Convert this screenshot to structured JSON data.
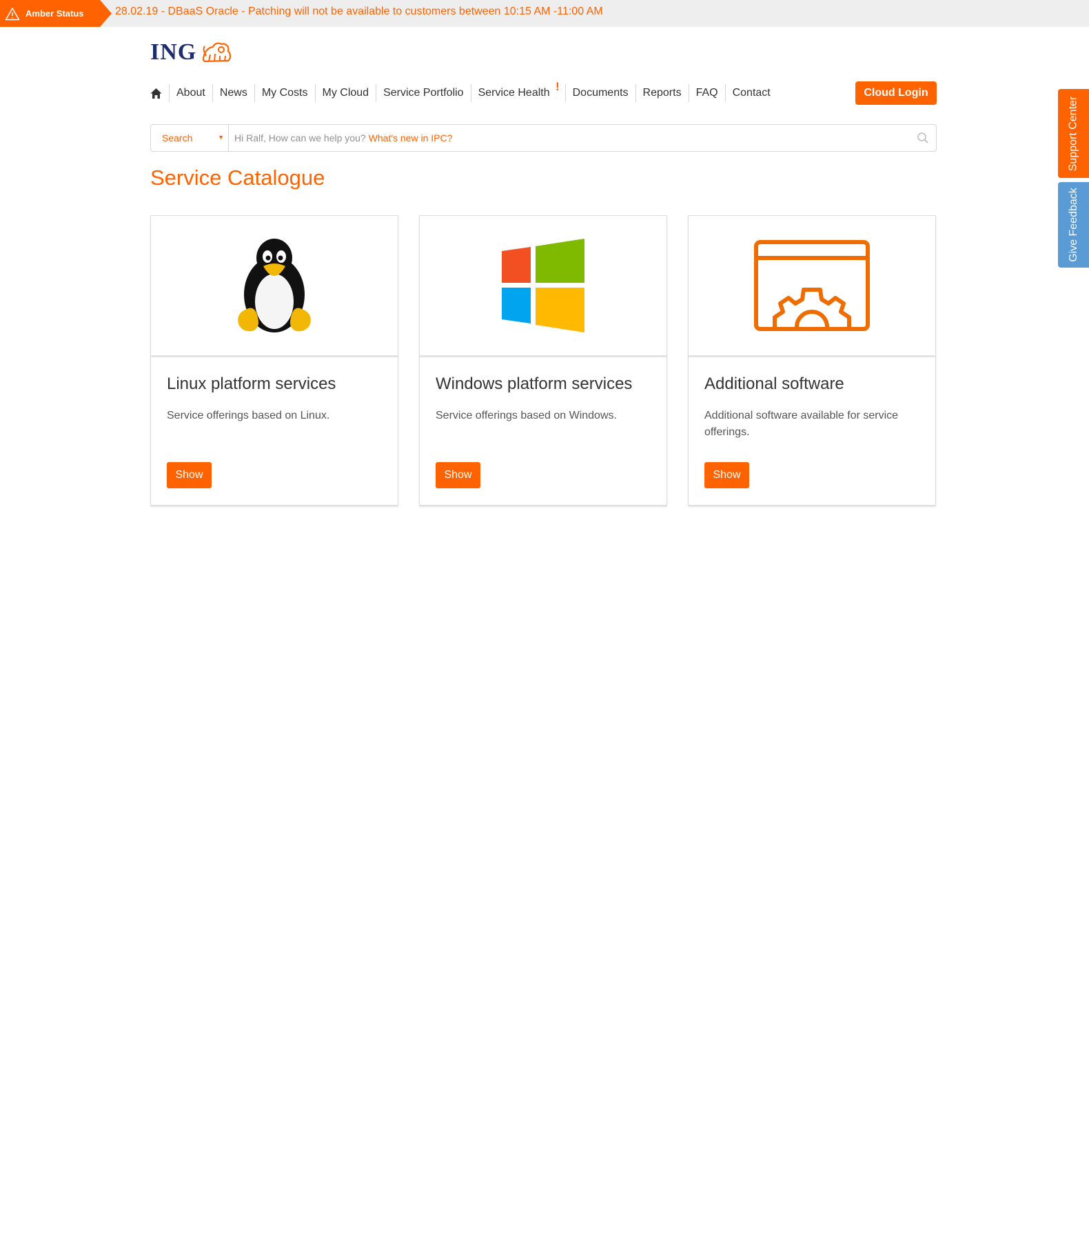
{
  "status": {
    "badge": "Amber Status",
    "message": "28.02.19 - DBaaS Oracle - Patching will not be available to customers between 10:15 AM -11:00 AM"
  },
  "logo": {
    "text": "ING"
  },
  "nav": {
    "items": [
      "About",
      "News",
      "My Costs",
      "My Cloud",
      "Service Portfolio",
      "Service Health",
      "Documents",
      "Reports",
      "FAQ",
      "Contact"
    ],
    "health_alert": "!"
  },
  "cloud_login": "Cloud Login",
  "search": {
    "scope": "Search",
    "prompt": "Hi Ralf, How can we help you?",
    "link": "What's new in IPC?"
  },
  "page_title": "Service Catalogue",
  "cards": [
    {
      "title": "Linux platform services",
      "desc": "Service offerings based on Linux.",
      "button": "Show",
      "icon": "linux-penguin-icon"
    },
    {
      "title": "Windows platform services",
      "desc": "Service offerings based on Windows.",
      "button": "Show",
      "icon": "windows-logo-icon"
    },
    {
      "title": "Additional software",
      "desc": "Additional software available for service offerings.",
      "button": "Show",
      "icon": "software-gear-icon"
    }
  ],
  "side_tabs": {
    "support": "Support Center",
    "feedback": "Give Feedback"
  },
  "colors": {
    "accent": "#ff6200",
    "brand_navy": "#1f2d6b",
    "feedback_blue": "#5b9bd5",
    "banner_bg": "#eeeeee"
  }
}
